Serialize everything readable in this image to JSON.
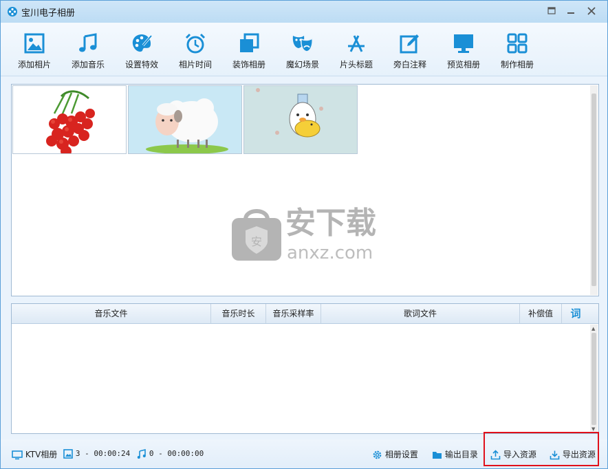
{
  "window": {
    "title": "宝川电子相册"
  },
  "toolbar": {
    "items": [
      {
        "label": "添加相片",
        "icon": "picture-icon"
      },
      {
        "label": "添加音乐",
        "icon": "music-note-icon"
      },
      {
        "label": "设置特效",
        "icon": "palette-icon"
      },
      {
        "label": "相片时间",
        "icon": "alarm-clock-icon"
      },
      {
        "label": "装饰相册",
        "icon": "layers-icon"
      },
      {
        "label": "魔幻场景",
        "icon": "masks-icon"
      },
      {
        "label": "片头标题",
        "icon": "app-store-icon"
      },
      {
        "label": "旁白注释",
        "icon": "edit-icon"
      },
      {
        "label": "预览相册",
        "icon": "monitor-icon"
      },
      {
        "label": "制作相册",
        "icon": "grid-icon"
      }
    ]
  },
  "photos": [
    {
      "name": "lychee"
    },
    {
      "name": "sheep"
    },
    {
      "name": "duck"
    }
  ],
  "watermark": {
    "text_cn": "安下载",
    "text_en": "anxz.com"
  },
  "music_table": {
    "columns": [
      "音乐文件",
      "音乐时长",
      "音乐采样率",
      "歌词文件",
      "补偿值",
      "词"
    ],
    "rows": []
  },
  "status": {
    "ktv_label": "KTV相册",
    "photo_count": "3 - 00:00:24",
    "music_count": "0 - 00:00:00",
    "album_settings": "相册设置",
    "output_dir": "输出目录",
    "import_res": "导入资源",
    "export_res": "导出资源"
  },
  "colors": {
    "accent": "#1a8fd6",
    "titlebar": "#c7e2f7",
    "highlight": "#e0101a"
  }
}
